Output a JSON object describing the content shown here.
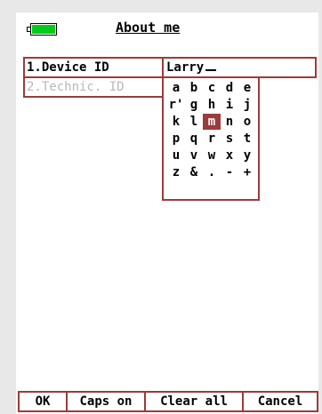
{
  "status": {
    "battery_icon": "battery-icon",
    "battery_level": 1.0,
    "battery_color": "#00cc1a"
  },
  "screen": {
    "title": "About me"
  },
  "fields": [
    {
      "label": "1.Device ID",
      "value": "Larry",
      "active": true
    },
    {
      "label": "2.Technic. ID",
      "active": false
    }
  ],
  "keypad": {
    "rows": [
      [
        "a",
        "b",
        "c",
        "d",
        "e"
      ],
      [
        "r'",
        "g",
        "h",
        "i",
        "j"
      ],
      [
        "k",
        "l",
        "m",
        "n",
        "o"
      ],
      [
        "p",
        "q",
        "r",
        "s",
        "t"
      ],
      [
        "u",
        "v",
        "w",
        "x",
        "y"
      ],
      [
        "z",
        "&",
        ".",
        "-",
        "+"
      ]
    ],
    "selected": "m",
    "selected_color": "#9b3b3b"
  },
  "softkeys": {
    "ok": "OK",
    "caps": "Caps on",
    "clear": "Clear all",
    "cancel": "Cancel"
  },
  "colors": {
    "accent": "#9b3b3b",
    "inactive_text": "#b8b8b8"
  }
}
